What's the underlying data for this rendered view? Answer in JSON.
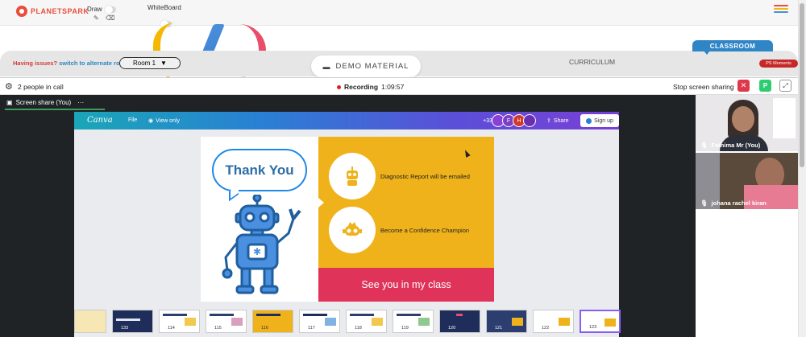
{
  "header": {
    "logo_text": "PLANETSPARK",
    "draw_label": "Draw",
    "whiteboard_label": "WhiteBoard",
    "hamburger_colors": [
      "#e94d3c",
      "#f5b800",
      "#4a90d9",
      "#e94d6a"
    ]
  },
  "classbar": {
    "issues_text": "Having issues?",
    "switch_link": "switch to alternate room",
    "room_label": "Room 1",
    "demo_label": "DEMO MATERIAL",
    "curriculum_label": "CURRICULUM",
    "classroom_label": "CLASSROOM",
    "moments_label": "PS Moments"
  },
  "callbar": {
    "people_text": "2 people in call",
    "recording_label": "Recording",
    "recording_time": "1:09:57",
    "stop_label": "Stop screen sharing",
    "close_symbol": "✕",
    "p_badge": "P",
    "expand_symbol": "⤢"
  },
  "screen": {
    "tab_label": "Screen share (You)",
    "tab_more": "···"
  },
  "canva": {
    "logo": "Canva",
    "file_label": "File",
    "view_label": "View only",
    "avatar_count": "+33",
    "avatar_letters": [
      "F",
      "H"
    ],
    "share_label": "Share",
    "signup_label": "Sign up"
  },
  "slide": {
    "thank_you": "Thank You",
    "line1": "Diagnostic Report will be emailed",
    "line2": "Become a Confidence Champion",
    "footer": "See you in my class"
  },
  "thumbnails": {
    "counts": [
      "133",
      "114",
      "115",
      "116",
      "117",
      "118",
      "119",
      "120",
      "121",
      "122",
      "123"
    ]
  },
  "videos": {
    "participant1": "Fathima Mr (You)",
    "participant2": "johana rachel kiran"
  },
  "colors": {
    "brand_red": "#e94d3c",
    "accent_blue": "#2f85c6",
    "slide_yellow": "#efb21a",
    "slide_pink": "#e0335a"
  }
}
